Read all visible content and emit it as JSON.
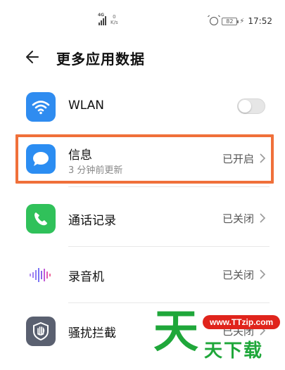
{
  "statusbar": {
    "network": "4G",
    "speed_value": "0",
    "speed_unit": "K/s",
    "battery": "82",
    "time": "17:52"
  },
  "header": {
    "title": "更多应用数据"
  },
  "items": [
    {
      "label": "WLAN",
      "icon": "wifi-icon",
      "control": "toggle",
      "toggle_on": false
    },
    {
      "label": "信息",
      "sub": "3 分钟前更新",
      "status": "已开启",
      "icon": "message-icon"
    },
    {
      "label": "通话记录",
      "status": "已关闭",
      "icon": "phone-icon"
    },
    {
      "label": "录音机",
      "status": "已关闭",
      "icon": "recorder-icon"
    },
    {
      "label": "骚扰拦截",
      "status": "已关闭",
      "icon": "hand-block-icon"
    }
  ],
  "watermark": {
    "big": "天",
    "url": "www.TTzip.com",
    "small": "天下载"
  },
  "colors": {
    "wifi_bg": "#2f8cf0",
    "message_bg": "#2b8df2",
    "phone_bg": "#30c15a",
    "highlight": "#f0703a",
    "watermark_green": "#1fa73a",
    "watermark_red": "#e0241c"
  }
}
